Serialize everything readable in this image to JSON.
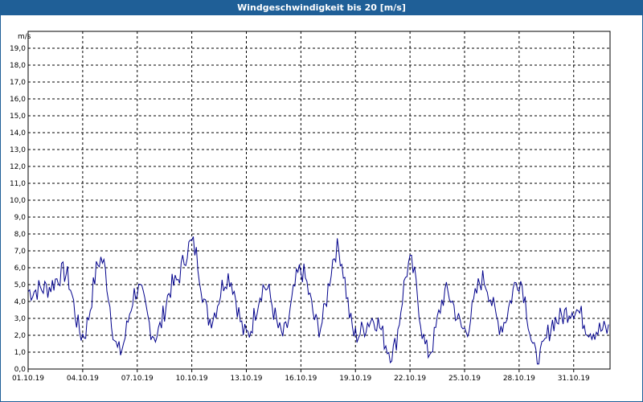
{
  "window": {
    "title": "Windgeschwindigkeit bis 20 [m/s]"
  },
  "colors": {
    "title_bar": "#1f5f97",
    "line": "#00008b",
    "grid": "#000000"
  },
  "chart_data": {
    "type": "line",
    "title": "Windgeschwindigkeit bis 20 [m/s]",
    "ylabel": "m/s",
    "xlabel": "",
    "ylim": [
      0,
      20
    ],
    "yticks": [
      "0,0",
      "1,0",
      "2,0",
      "3,0",
      "4,0",
      "5,0",
      "6,0",
      "7,0",
      "8,0",
      "9,0",
      "10,0",
      "11,0",
      "12,0",
      "13,0",
      "14,0",
      "15,0",
      "16,0",
      "17,0",
      "18,0",
      "19,0"
    ],
    "xlim": [
      "2019-10-01",
      "2019-11-02"
    ],
    "xtick_labels": [
      "01.10.19",
      "04.10.19",
      "07.10.19",
      "10.10.19",
      "13.10.19",
      "16.10.19",
      "19.10.19",
      "22.10.19",
      "25.10.19",
      "28.10.19",
      "31.10.19"
    ],
    "grid": true,
    "series": [
      {
        "x": [
          "2019-10-01",
          "2019-10-02",
          "2019-10-03",
          "2019-10-04",
          "2019-10-05",
          "2019-10-06",
          "2019-10-07",
          "2019-10-08",
          "2019-10-09",
          "2019-10-10",
          "2019-10-11",
          "2019-10-12",
          "2019-10-13",
          "2019-10-14",
          "2019-10-15",
          "2019-10-16",
          "2019-10-17",
          "2019-10-18",
          "2019-10-19",
          "2019-10-20",
          "2019-10-21",
          "2019-10-22",
          "2019-10-23",
          "2019-10-24",
          "2019-10-25",
          "2019-10-26",
          "2019-10-27",
          "2019-10-28",
          "2019-10-29",
          "2019-10-30",
          "2019-10-31",
          "2019-11-01"
        ],
        "values": [
          4.6,
          4.8,
          5.7,
          2.0,
          6.5,
          1.0,
          4.7,
          2.0,
          5.0,
          7.4,
          3.0,
          5.5,
          2.0,
          4.9,
          2.0,
          5.8,
          2.5,
          7.1,
          2.0,
          3.0,
          1.0,
          6.2,
          1.0,
          4.5,
          2.3,
          5.3,
          2.6,
          5.3,
          0.6,
          2.9,
          3.6,
          2.3
        ]
      }
    ]
  }
}
